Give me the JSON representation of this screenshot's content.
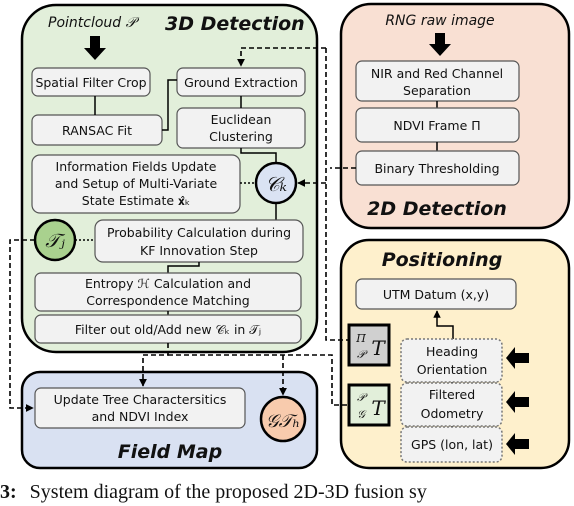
{
  "panels": {
    "detection3d": {
      "title": "3D Detection",
      "input_label": "Pointcloud 𝒫",
      "boxes": {
        "spatial_filter": "Spatial Filter Crop",
        "ransac": "RANSAC Fit",
        "ground_extraction": "Ground Extraction",
        "euclidean_1": "Euclidean",
        "euclidean_2": "Clustering",
        "info_1": "Information Fields Update",
        "info_2": "and Setup of Multi-Variate",
        "info_3": "State Estimate 𝐱̂ₖ",
        "prob_1": "Probability Calculation during",
        "prob_2": "KF Innovation Step",
        "entropy_1": "Entropy ℋ Calculation and",
        "entropy_2": "Correspondence Matching",
        "filter": "Filter out old/Add new 𝒞ₖ in 𝒯ⱼ"
      },
      "nodes": {
        "ck": "𝒞ₖ",
        "tj": "𝒯ⱼ"
      }
    },
    "detection2d": {
      "title": "2D Detection",
      "input_label": "RNG raw image",
      "boxes": {
        "nir_1": "NIR and Red Channel",
        "nir_2": "Separation",
        "ndvi": "NDVI Frame Π",
        "binary": "Binary Thresholding"
      }
    },
    "positioning": {
      "title": "Positioning",
      "boxes": {
        "utm": "UTM Datum (x,y)",
        "heading_1": "Heading",
        "heading_2": "Orientation",
        "odom_1": "Filtered",
        "odom_2": "Odometry",
        "gps": "GPS (lon, lat)"
      },
      "transforms": {
        "pi_p_top": "Π",
        "pi_p_bottom": "𝒫",
        "p_g_top": "𝒫",
        "p_g_bottom": "𝒢",
        "T": "T"
      }
    },
    "field_map": {
      "title": "Field Map",
      "box_1": "Update Tree Charactersitics",
      "box_2": "and NDVI Index",
      "node": "𝒢𝒯ₕ"
    }
  },
  "caption": {
    "label": "3:",
    "text": "System diagram of the proposed 2D-3D fusion sy"
  },
  "colors": {
    "green_panel": "#e2efda",
    "peach_panel": "#f9e0d3",
    "yellow_panel": "#fef0cc",
    "blue_panel": "#d9e1f2",
    "box_fill": "#f2f2f2",
    "ck_node": "#dae3f3",
    "tj_node": "#a9d18e",
    "gth_node": "#f8cbad",
    "pi_transform": "#d0d0d0",
    "pg_transform": "#e2efda"
  }
}
